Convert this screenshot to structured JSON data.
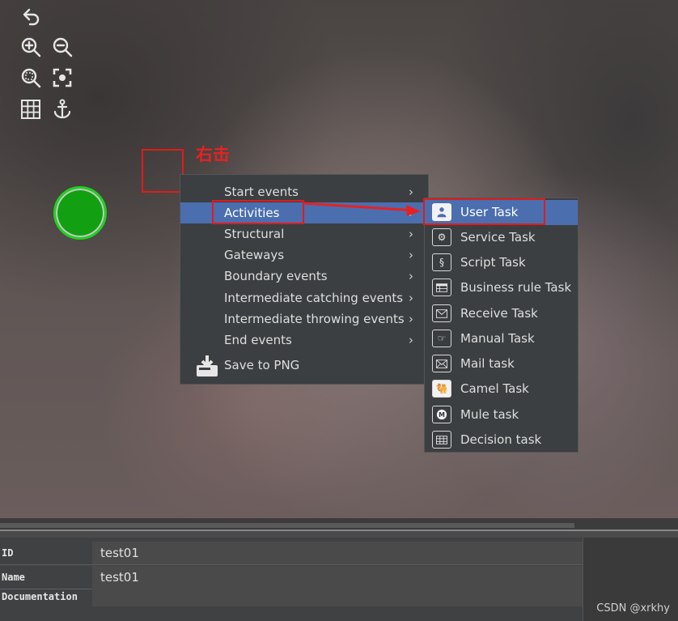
{
  "annotation": {
    "text": "右击"
  },
  "context_menu": {
    "items": [
      {
        "label": "Start events",
        "has_submenu": true
      },
      {
        "label": "Activities",
        "has_submenu": true,
        "selected": true
      },
      {
        "label": "Structural",
        "has_submenu": true
      },
      {
        "label": "Gateways",
        "has_submenu": true
      },
      {
        "label": "Boundary events",
        "has_submenu": true
      },
      {
        "label": "Intermediate catching events",
        "has_submenu": true
      },
      {
        "label": "Intermediate throwing events",
        "has_submenu": true
      },
      {
        "label": "End events",
        "has_submenu": true
      },
      {
        "label": "Save to PNG",
        "has_submenu": false,
        "icon": "save-icon"
      }
    ]
  },
  "submenu": {
    "items": [
      {
        "label": "User Task",
        "icon": "user-task-icon",
        "selected": true
      },
      {
        "label": "Service Task",
        "icon": "service-task-icon"
      },
      {
        "label": "Script Task",
        "icon": "script-task-icon"
      },
      {
        "label": "Business rule Task",
        "icon": "business-rule-task-icon"
      },
      {
        "label": "Receive Task",
        "icon": "receive-task-icon"
      },
      {
        "label": "Manual Task",
        "icon": "manual-task-icon"
      },
      {
        "label": "Mail task",
        "icon": "mail-task-icon"
      },
      {
        "label": "Camel Task",
        "icon": "camel-task-icon"
      },
      {
        "label": "Mule task",
        "icon": "mule-task-icon"
      },
      {
        "label": "Decision task",
        "icon": "decision-task-icon"
      }
    ]
  },
  "properties": {
    "rows": [
      {
        "label": "ID",
        "value": "test01"
      },
      {
        "label": "Name",
        "value": "test01"
      },
      {
        "label": "Documentation",
        "value": ""
      }
    ]
  },
  "watermark": "CSDN @xrkhy",
  "colors": {
    "selection": "#4b6eaf",
    "annotation": "#e01b1b",
    "start_event": "#12a012"
  }
}
